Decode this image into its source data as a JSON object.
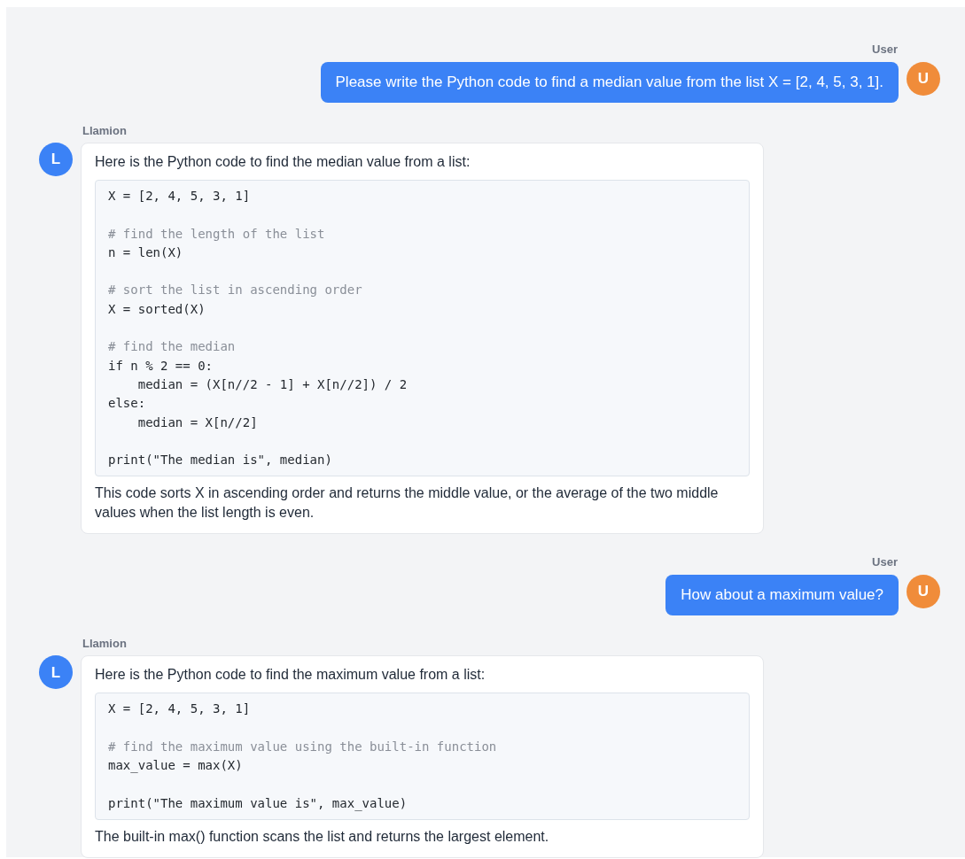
{
  "messages": [
    {
      "kind": "user",
      "author": "User",
      "avatar": "U",
      "text": "Please write the Python code to find a median value from the list X = [2, 4, 5, 3, 1]."
    },
    {
      "kind": "assistant",
      "author": "Llamion",
      "avatar": "L",
      "intro": "Here is the Python code to find the median value from a list:",
      "code": [
        {
          "kind": "code",
          "text": "X = [2, 4, 5, 3, 1]"
        },
        {
          "kind": "blank"
        },
        {
          "kind": "comment",
          "text": "# find the length of the list"
        },
        {
          "kind": "code",
          "text": "n = len(X)"
        },
        {
          "kind": "blank"
        },
        {
          "kind": "comment",
          "text": "# sort the list in ascending order"
        },
        {
          "kind": "code",
          "text": "X = sorted(X)"
        },
        {
          "kind": "blank"
        },
        {
          "kind": "comment",
          "text": "# find the median"
        },
        {
          "kind": "code",
          "text": "if n % 2 == 0:"
        },
        {
          "kind": "code",
          "text": "    median = (X[n//2 - 1] + X[n//2]) / 2"
        },
        {
          "kind": "code",
          "text": "else:"
        },
        {
          "kind": "code",
          "text": "    median = X[n//2]"
        },
        {
          "kind": "blank"
        },
        {
          "kind": "code",
          "text": "print(\"The median is\", median)"
        }
      ],
      "outro": "This code sorts X in ascending order and returns the middle value, or the average of the two middle values when the list length is even."
    },
    {
      "kind": "user",
      "author": "User",
      "avatar": "U",
      "text": "How about a maximum value?"
    },
    {
      "kind": "assistant",
      "author": "Llamion",
      "avatar": "L",
      "intro": "Here is the Python code to find the maximum value from a list:",
      "code": [
        {
          "kind": "code",
          "text": "X = [2, 4, 5, 3, 1]"
        },
        {
          "kind": "blank"
        },
        {
          "kind": "comment",
          "text": "# find the maximum value using the built-in function"
        },
        {
          "kind": "code",
          "text": "max_value = max(X)"
        },
        {
          "kind": "blank"
        },
        {
          "kind": "code",
          "text": "print(\"The maximum value is\", max_value)"
        }
      ],
      "outro": "The built-in max() function scans the list and returns the largest element."
    }
  ]
}
